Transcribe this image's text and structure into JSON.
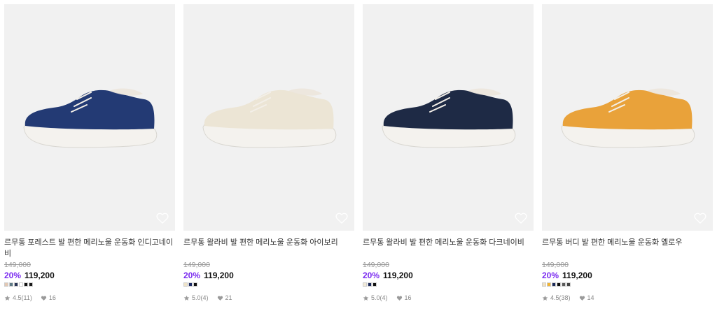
{
  "products": [
    {
      "title": "르무통 포레스트 발 편한 메리노울 운동화 인디고네이비",
      "original_price": "149,000",
      "discount": "20%",
      "price": "119,200",
      "swatches": [
        "#e3c8b4",
        "#5f7a86",
        "#2a3556",
        "#ffffff",
        "#111111",
        "#1a1a1a"
      ],
      "rating": "4.5(11)",
      "likes": "16",
      "shoe_color": "#233a74"
    },
    {
      "title": "르무통 왈라비 발 편한 메리노울 운동화 아이보리",
      "original_price": "149,000",
      "discount": "20%",
      "price": "119,200",
      "swatches": [
        "#efe3c8",
        "#1e2d66",
        "#111111"
      ],
      "rating": "5.0(4)",
      "likes": "21",
      "shoe_color": "#ece5d5"
    },
    {
      "title": "르무통 왈라비 발 편한 메리노울 운동화 다크네이비",
      "original_price": "149,000",
      "discount": "20%",
      "price": "119,200",
      "swatches": [
        "#f2ead8",
        "#1c2a5c",
        "#111111"
      ],
      "rating": "5.0(4)",
      "likes": "16",
      "shoe_color": "#1e2a45"
    },
    {
      "title": "르무통 버디 발 편한 메리노울 운동화 옐로우",
      "original_price": "149,000",
      "discount": "20%",
      "price": "119,200",
      "swatches": [
        "#f0e2c4",
        "#f1b431",
        "#1d2b5a",
        "#111111",
        "#5a5a5a",
        "#444444"
      ],
      "rating": "4.5(38)",
      "likes": "14",
      "shoe_color": "#e9a23a"
    }
  ]
}
